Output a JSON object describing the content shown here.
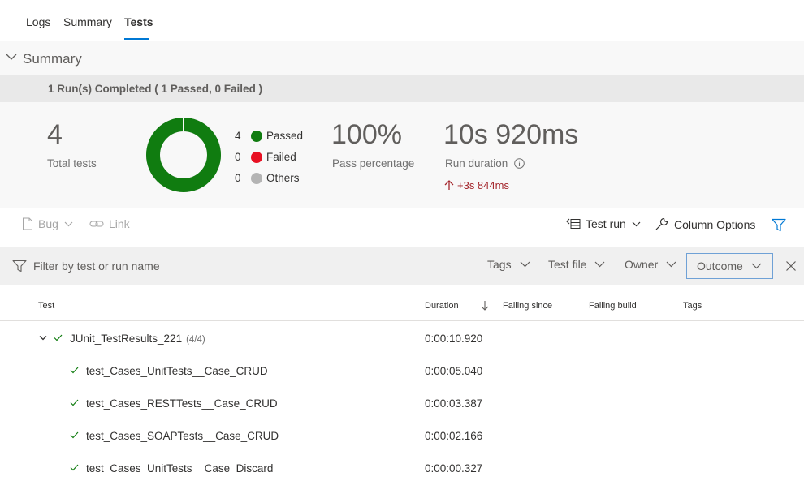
{
  "tabs": [
    {
      "label": "Logs"
    },
    {
      "label": "Summary"
    },
    {
      "label": "Tests"
    }
  ],
  "summary": {
    "header_title": "Summary",
    "runs_completed": "1 Run(s) Completed ( 1 Passed, 0 Failed )",
    "total_tests_value": "4",
    "total_tests_label": "Total tests",
    "legend": [
      {
        "count": "4",
        "label": "Passed",
        "color": "#107c10"
      },
      {
        "count": "0",
        "label": "Failed",
        "color": "#e81123"
      },
      {
        "count": "0",
        "label": "Others",
        "color": "#b4b4b4"
      }
    ],
    "donut_passed_fraction": 1.0,
    "pass_percentage_value": "100%",
    "pass_percentage_label": "Pass percentage",
    "run_duration_value": "10s 920ms",
    "run_duration_label": "Run duration",
    "duration_delta": "+3s 844ms"
  },
  "toolbar": {
    "bug_label": "Bug",
    "link_label": "Link",
    "test_run_label": "Test run",
    "column_options_label": "Column Options"
  },
  "filters": {
    "search_placeholder": "Filter by test or run name",
    "tags_label": "Tags",
    "test_file_label": "Test file",
    "owner_label": "Owner",
    "outcome_label": "Outcome"
  },
  "grid": {
    "columns": {
      "test": "Test",
      "duration": "Duration",
      "failing_since": "Failing since",
      "failing_build": "Failing build",
      "tags": "Tags"
    },
    "group": {
      "name": "JUnit_TestResults_221",
      "count": "(4/4)",
      "duration": "0:00:10.920"
    },
    "rows": [
      {
        "name": "test_Cases_UnitTests__Case_CRUD",
        "duration": "0:00:05.040"
      },
      {
        "name": "test_Cases_RESTTests__Case_CRUD",
        "duration": "0:00:03.387"
      },
      {
        "name": "test_Cases_SOAPTests__Case_CRUD",
        "duration": "0:00:02.166"
      },
      {
        "name": "test_Cases_UnitTests__Case_Discard",
        "duration": "0:00:00.327"
      }
    ]
  },
  "colors": {
    "accent": "#0078d4",
    "passed": "#107c10",
    "failed": "#e81123",
    "delta_up": "#a4262c"
  },
  "icons": {
    "summary_collapse": "chevron-down-icon",
    "bug": "document-icon",
    "link": "link-icon",
    "test_run": "list-icon",
    "column_options": "wrench-icon",
    "filter": "filter-icon",
    "close": "close-icon",
    "sort": "arrow-down-icon",
    "passed": "check-icon",
    "info": "info-icon",
    "delta": "arrow-up-icon"
  }
}
